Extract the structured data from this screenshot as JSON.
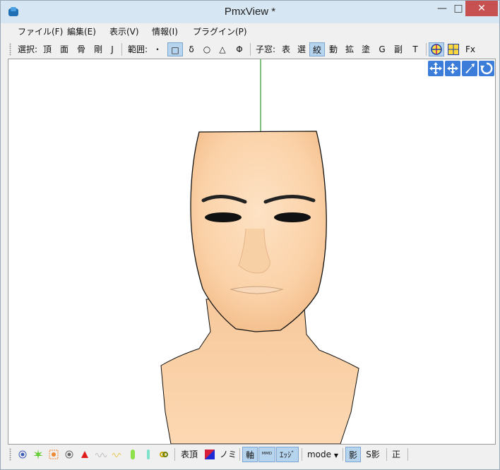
{
  "window": {
    "title": "PmxView *"
  },
  "menu": [
    "ファイル(F)",
    "編集(E)",
    "表示(V)",
    "情報(I)",
    "プラグイン(P)"
  ],
  "toolbar": {
    "select_label": "選択:",
    "select_items": [
      "頂",
      "面",
      "骨",
      "剛",
      "J"
    ],
    "range_label": "範囲:",
    "range_items": [
      "・",
      "□",
      "δ",
      "○",
      "△",
      "Φ"
    ],
    "child_label": "子窓:",
    "child_items": [
      "表",
      "選",
      "絞",
      "動",
      "拡",
      "塗",
      "G",
      "副",
      "T"
    ],
    "fx_label": "Fx"
  },
  "statusbar": {
    "items": [
      "表頂",
      "ノミ",
      "軸",
      "ᴹᴹᴰ",
      "ｴｯｼﾞ"
    ],
    "mode_label": "mode",
    "shadow_label": "影",
    "sshadow_label": "S影",
    "correct_label": "正"
  },
  "colors": {
    "accent": "#3b7dd8",
    "selected_bg": "#b7d4ee",
    "axis_green": "#2a9a2a",
    "skin": "#fcd6ae"
  }
}
